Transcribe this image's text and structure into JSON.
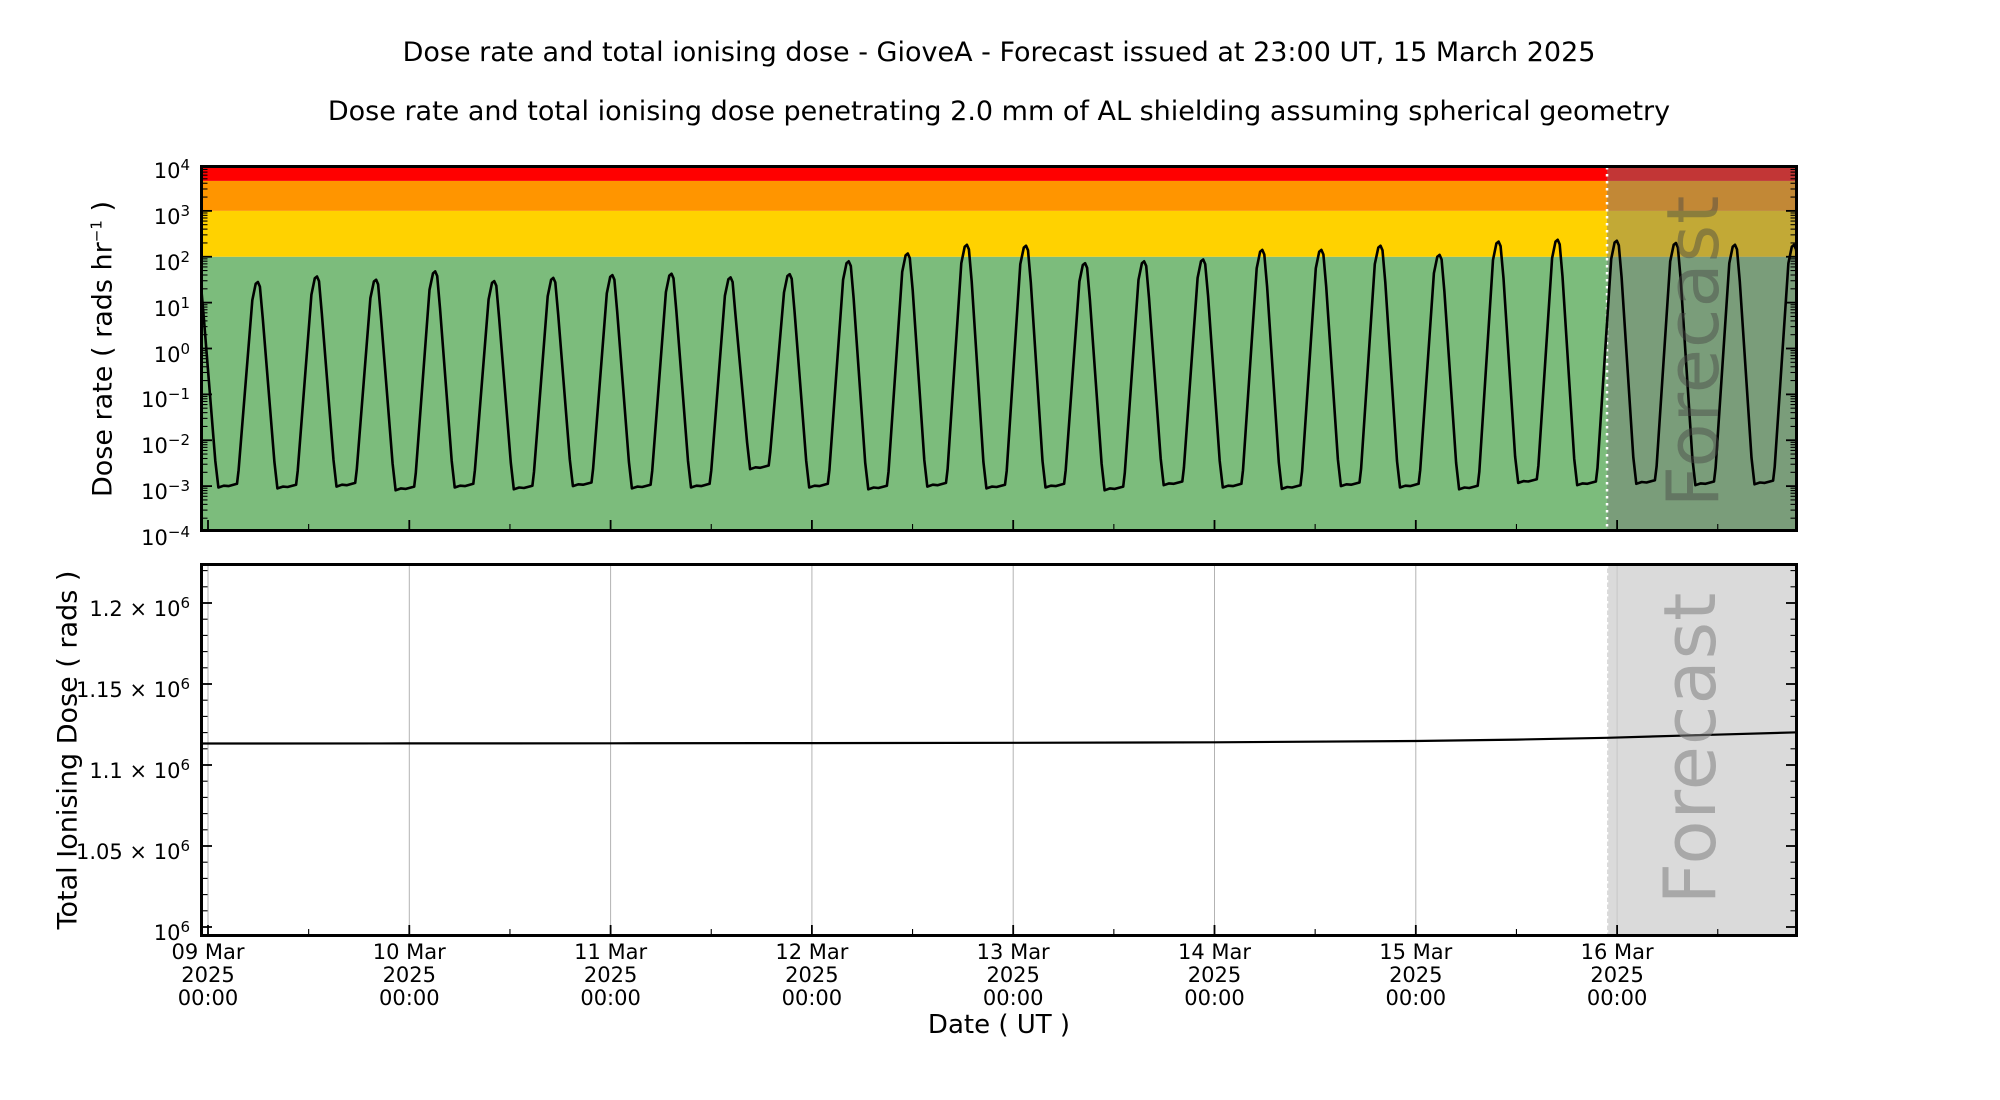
{
  "page": {
    "title": "Dose rate and total ionising dose - GioveA - Forecast issued at 23:00 UT, 15 March 2025",
    "subtitle": "Dose rate and total ionising dose penetrating 2.0 mm of AL shielding assuming spherical geometry",
    "xlabel": "Date ( UT )"
  },
  "top_chart": {
    "ylabel_pre": "Dose rate ( rads hr",
    "ylabel_sup": "−1",
    "ylabel_post": " )",
    "watermark": "Forecast"
  },
  "bottom_chart": {
    "ylabel": "Total Ionising Dose ( rads )",
    "watermark": "Forecast"
  },
  "x_axis": {
    "tick_labels": [
      {
        "date": "09 Mar",
        "year": "2025",
        "time": "00:00"
      },
      {
        "date": "10 Mar",
        "year": "2025",
        "time": "00:00"
      },
      {
        "date": "11 Mar",
        "year": "2025",
        "time": "00:00"
      },
      {
        "date": "12 Mar",
        "year": "2025",
        "time": "00:00"
      },
      {
        "date": "13 Mar",
        "year": "2025",
        "time": "00:00"
      },
      {
        "date": "14 Mar",
        "year": "2025",
        "time": "00:00"
      },
      {
        "date": "15 Mar",
        "year": "2025",
        "time": "00:00"
      },
      {
        "date": "16 Mar",
        "year": "2025",
        "time": "00:00"
      }
    ]
  },
  "chart_data": [
    {
      "id": "dose_rate",
      "type": "line",
      "title": "Dose rate",
      "ylabel": "Dose rate ( rads hr^-1 )",
      "y_scale": "log10",
      "y_range_log10": [
        -4,
        4
      ],
      "y_ticks_log10": [
        4,
        3,
        2,
        1,
        0,
        -1,
        -2,
        -3,
        -4
      ],
      "x_unit": "days since 09 Mar 2025 00:00 UT",
      "x_range_days": [
        -0.04,
        7.9
      ],
      "x_major_tick_days": [
        0,
        1,
        2,
        3,
        4,
        5,
        6,
        7
      ],
      "x_minor_step_days": 0.5,
      "bands": [
        {
          "name": "green",
          "from": 0.0001,
          "to": 100,
          "color": "#7CBC7C"
        },
        {
          "name": "yellow",
          "from": 100,
          "to": 1000,
          "color": "#FFD200"
        },
        {
          "name": "orange",
          "from": 1000,
          "to": 4500,
          "color": "#FF9500"
        },
        {
          "name": "red",
          "from": 4500,
          "to": 10000,
          "color": "#FF0000"
        }
      ],
      "line_color": "#000000",
      "forecast_start_day": 6.95,
      "forecast_overlay_color": "rgba(120,120,120,0.45)",
      "forecast_divider_color": "#FFFFFF",
      "orbit_period_days": 0.2935,
      "first_peak_day": 0.248,
      "prelude_peak_log10": 1.5,
      "peaks_log10": [
        1.45,
        1.57,
        1.5,
        1.68,
        1.47,
        1.54,
        1.6,
        1.63,
        1.55,
        1.62,
        1.9,
        2.07,
        2.26,
        2.24,
        1.86,
        1.9,
        1.94,
        2.15,
        2.15,
        2.24,
        2.04,
        2.33,
        2.37,
        2.35,
        2.3,
        2.26,
        2.26
      ],
      "troughs_log10": [
        -3.0,
        -3.02,
        -2.98,
        -3.06,
        -3.0,
        -3.04,
        -2.97,
        -3.02,
        -3.0,
        -2.6,
        -3.0,
        -3.04,
        -2.98,
        -3.02,
        -3.0,
        -3.06,
        -2.95,
        -3.0,
        -3.03,
        -2.97,
        -3.0,
        -3.04,
        -2.9,
        -2.95,
        -2.92,
        -2.95,
        -2.93,
        -2.95
      ],
      "cycle_shape": [
        [
          -0.146,
          "T",
          0.0
        ],
        [
          -0.104,
          "T",
          0.05
        ],
        [
          -0.096,
          "T",
          0.35
        ],
        [
          -0.028,
          "P",
          -0.4
        ],
        [
          -0.011,
          "P",
          -0.04
        ],
        [
          0.0,
          "P",
          0.0
        ],
        [
          0.01,
          "P",
          -0.1
        ],
        [
          0.024,
          "P",
          -0.8
        ],
        [
          0.082,
          "T",
          0.55
        ],
        [
          0.097,
          "T",
          -0.03
        ],
        [
          0.124,
          "T",
          0.01
        ]
      ]
    },
    {
      "id": "total_ionising_dose",
      "type": "line",
      "title": "Total Ionising Dose",
      "ylabel": "Total Ionising Dose ( rads )",
      "y_scale": "linear",
      "y_range": [
        994000,
        1224700
      ],
      "y_tick_values": [
        1200000,
        1150000,
        1100000,
        1050000,
        1000000
      ],
      "y_minor_step": 10000,
      "grid_color": "#B3B3B3",
      "line_color": "#000000",
      "forecast_start_day": 6.95,
      "forecast_band_color": "rgba(205,205,205,0.75)",
      "points": [
        [
          -0.04,
          1113300
        ],
        [
          1.0,
          1113350
        ],
        [
          2.0,
          1113400
        ],
        [
          3.0,
          1113500
        ],
        [
          4.0,
          1113700
        ],
        [
          5.0,
          1114000
        ],
        [
          6.0,
          1114800
        ],
        [
          6.5,
          1115700
        ],
        [
          6.95,
          1116800
        ],
        [
          7.4,
          1118400
        ],
        [
          7.9,
          1120200
        ]
      ]
    }
  ]
}
